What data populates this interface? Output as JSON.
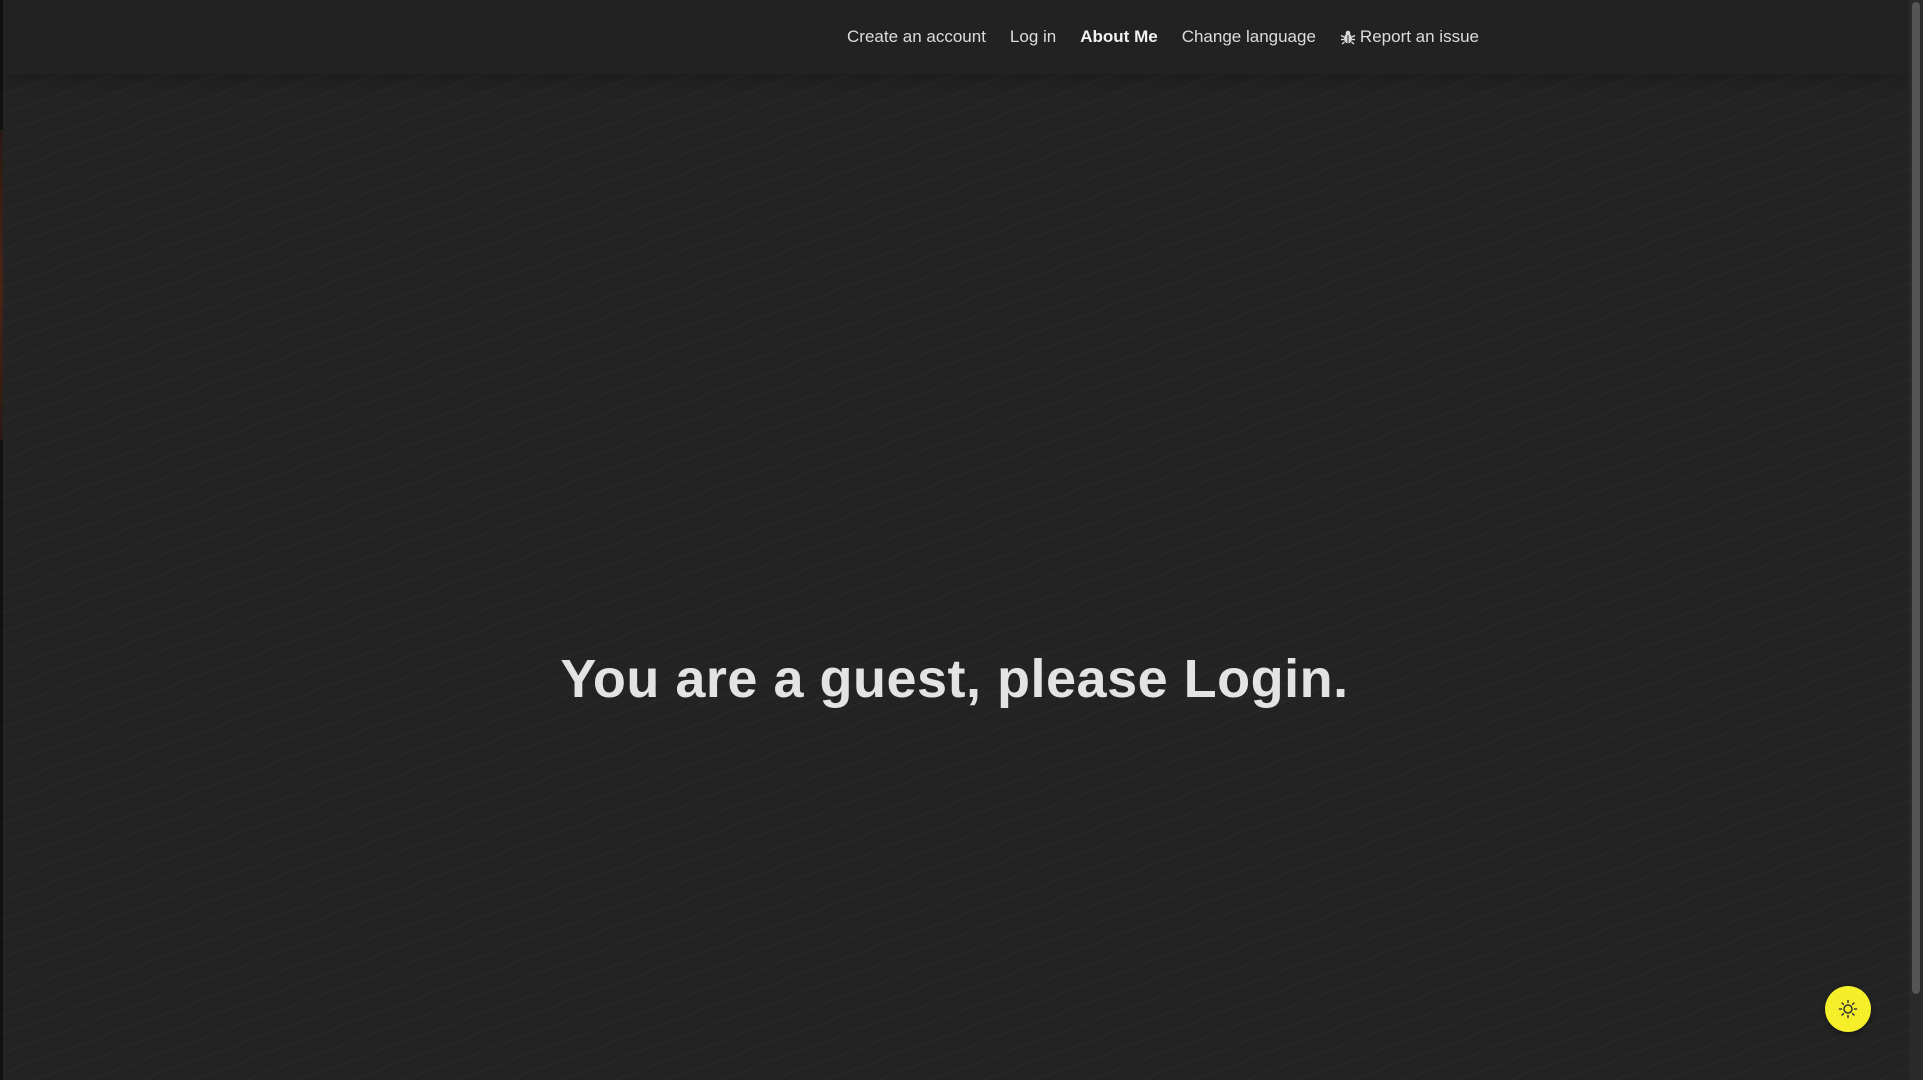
{
  "nav": {
    "items": [
      {
        "label": "Create an account"
      },
      {
        "label": "Log in"
      },
      {
        "label": "About Me"
      },
      {
        "label": "Change language"
      },
      {
        "label": "Report an issue",
        "icon": "bug-icon"
      }
    ],
    "active_item": "About Me"
  },
  "main": {
    "headline": "You are a guest, please Login."
  },
  "theme_toggle": {
    "icon": "sun-icon",
    "color": "#f5ef2a"
  },
  "colors": {
    "background": "#232323",
    "navbar": "#222222",
    "text": "#e3e3e3"
  }
}
